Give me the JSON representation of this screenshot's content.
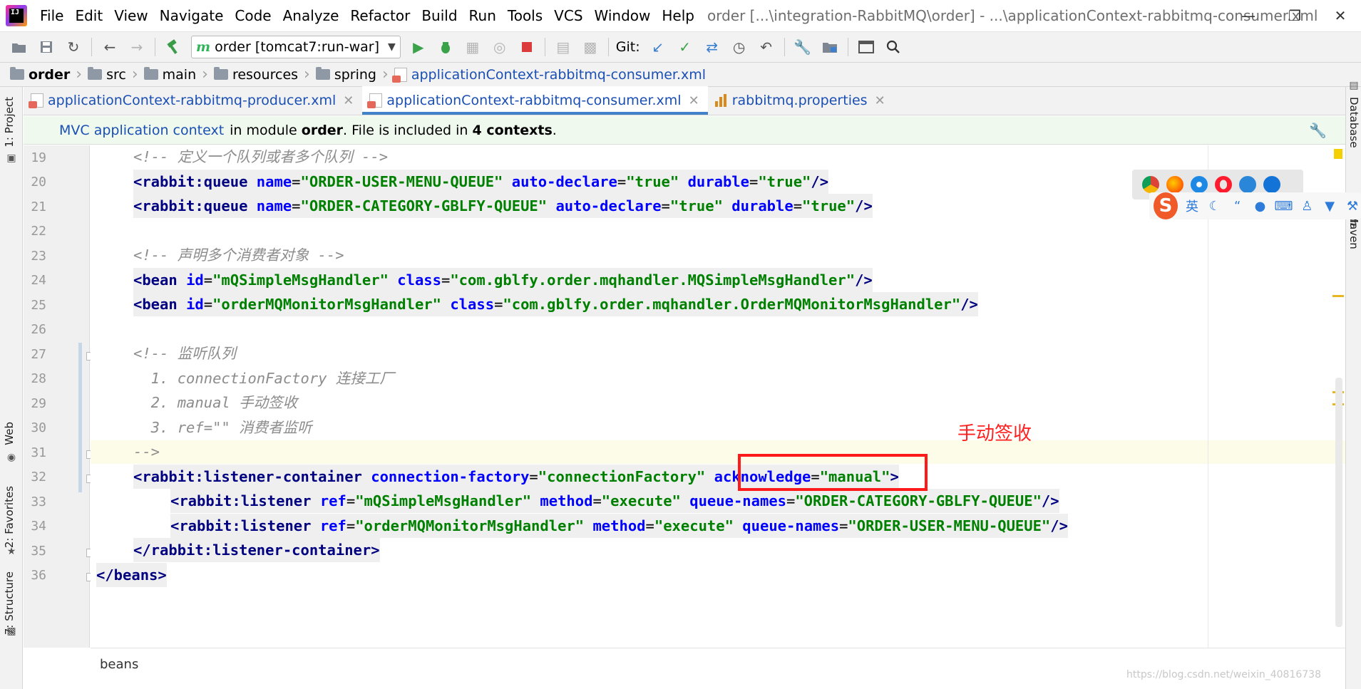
{
  "menubar": {
    "items": [
      "File",
      "Edit",
      "View",
      "Navigate",
      "Code",
      "Analyze",
      "Refactor",
      "Build",
      "Run",
      "Tools",
      "VCS",
      "Window",
      "Help"
    ],
    "window_title": "order [...\\integration-RabbitMQ\\order] - ...\\applicationContext-rabbitmq-consumer.xml",
    "logo_text": "IJ"
  },
  "toolbar": {
    "run_config": "order [tomcat7:run-war]",
    "git_label": "Git:"
  },
  "breadcrumb": {
    "items": [
      "order",
      "src",
      "main",
      "resources",
      "spring",
      "applicationContext-rabbitmq-consumer.xml"
    ]
  },
  "left_strip": {
    "project": "1: Project",
    "web": "Web",
    "favorites": "2: Favorites",
    "structure": "7: Structure"
  },
  "right_strip": {
    "database": "Database",
    "maven": "Maven"
  },
  "tabs": [
    {
      "label": "applicationContext-rabbitmq-producer.xml"
    },
    {
      "label": "applicationContext-rabbitmq-consumer.xml"
    },
    {
      "label": "rabbitmq.properties"
    }
  ],
  "context_banner": {
    "link": "MVC application context",
    "text_before": "in module ",
    "module": "order",
    "text_middle": ". File is included in ",
    "contexts": "4 contexts",
    "text_after": "."
  },
  "editor": {
    "line_numbers": [
      "19",
      "20",
      "21",
      "22",
      "23",
      "24",
      "25",
      "26",
      "27",
      "28",
      "29",
      "30",
      "31",
      "32",
      "33",
      "34",
      "35",
      "36"
    ],
    "lines": {
      "l19": "<!-- 定义一个队列或者多个队列 -->",
      "l20_tag": "<rabbit:queue",
      "l20_a1": "name",
      "l20_v1": "\"ORDER-USER-MENU-QUEUE\"",
      "l20_a2": "auto-declare",
      "l20_v2": "\"true\"",
      "l20_a3": "durable",
      "l20_v3": "\"true\"",
      "l21_tag": "<rabbit:queue",
      "l21_a1": "name",
      "l21_v1": "\"ORDER-CATEGORY-GBLFY-QUEUE\"",
      "l21_a2": "auto-declare",
      "l21_v2": "\"true\"",
      "l21_a3": "durable",
      "l21_v3": "\"true\"",
      "l23": "<!-- 声明多个消费者对象 -->",
      "l24_tag": "<bean",
      "l24_a1": "id",
      "l24_v1": "\"mQSimpleMsgHandler\"",
      "l24_a2": "class",
      "l24_v2": "\"com.gblfy.order.mqhandler.MQSimpleMsgHandler\"",
      "l25_tag": "<bean",
      "l25_a1": "id",
      "l25_v1": "\"orderMQMonitorMsgHandler\"",
      "l25_a2": "class",
      "l25_v2": "\"com.gblfy.order.mqhandler.OrderMQMonitorMsgHandler\"",
      "l27": "<!-- 监听队列",
      "l28": "  1. connectionFactory 连接工厂",
      "l29": "  2. manual 手动签收",
      "l30": "  3. ref=\"\" 消费者监听",
      "l31": "-->",
      "l32_tag": "<rabbit:listener-container",
      "l32_a1": "connection-factory",
      "l32_v1": "\"connectionFactory\"",
      "l32_a2": "acknowledge",
      "l32_v2": "\"manual\"",
      "l33_tag": "<rabbit:listener",
      "l33_a1": "ref",
      "l33_v1": "\"mQSimpleMsgHandler\"",
      "l33_a2": "method",
      "l33_v2": "\"execute\"",
      "l33_a3": "queue-names",
      "l33_v3": "\"ORDER-CATEGORY-GBLFY-QUEUE\"",
      "l34_tag": "<rabbit:listener",
      "l34_a1": "ref",
      "l34_v1": "\"orderMQMonitorMsgHandler\"",
      "l34_a2": "method",
      "l34_v2": "\"execute\"",
      "l34_a3": "queue-names",
      "l34_v3": "\"ORDER-USER-MENU-QUEUE\"",
      "l35_tag": "</rabbit:listener-container",
      "l36_tag": "</beans"
    }
  },
  "annotation": {
    "text": "手动签收",
    "color": "#ff2020"
  },
  "bottom": {
    "breadcrumb": "beans",
    "watermark": "https://blog.csdn.net/weixin_40816738"
  },
  "ime": {
    "logo": "S",
    "lang": "英"
  },
  "colors": {
    "tag": "#000080",
    "attr": "#0000ff",
    "value": "#008000",
    "comment": "#8c8c8c",
    "active_tab_underline": "#4083c9"
  }
}
